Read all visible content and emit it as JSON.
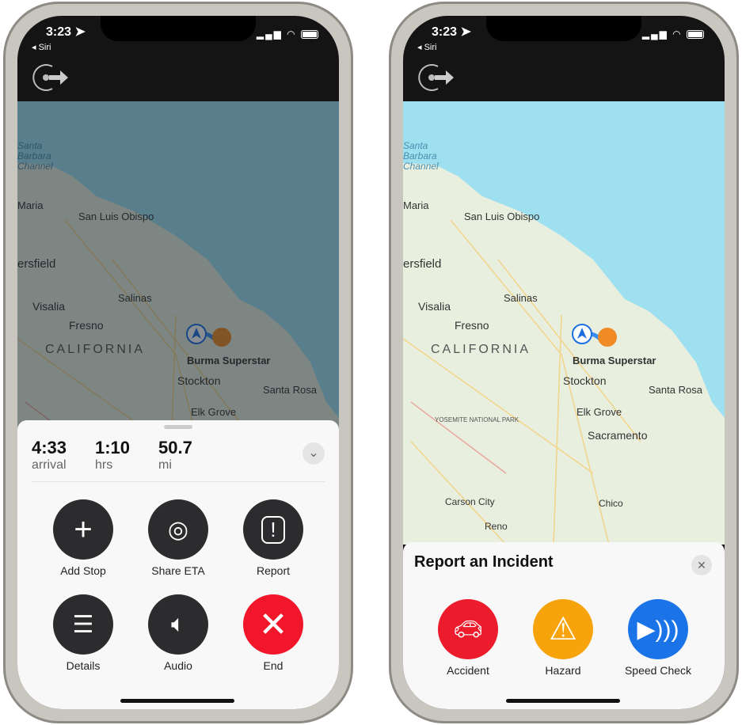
{
  "status": {
    "time": "3:23",
    "back": "Siri"
  },
  "map": {
    "water_label": "Santa\nBarbara\nChannel",
    "labels": [
      "Maria",
      "San Luis Obispo",
      "ersfield",
      "Visalia",
      "Fresno",
      "Salinas",
      "CALIFORNIA",
      "Burma Superstar",
      "Stockton",
      "Santa Rosa",
      "Elk Grove"
    ],
    "extra_labels": [
      "Sacramento",
      "YOSEMITE NATIONAL PARK",
      "Carson City",
      "Chico",
      "Reno"
    ]
  },
  "trip": {
    "arrival": "4:33",
    "arrival_unit": "arrival",
    "duration": "1:10",
    "duration_unit": "hrs",
    "distance": "50.7",
    "distance_unit": "mi"
  },
  "actions": [
    "Add Stop",
    "Share ETA",
    "Report",
    "Details",
    "Audio",
    "End"
  ],
  "report": {
    "title": "Report an Incident",
    "options": [
      "Accident",
      "Hazard",
      "Speed Check"
    ]
  },
  "colors": {
    "end": "#f2162b",
    "accident": "#ec1c2c",
    "hazard": "#f7a40c",
    "speed": "#1b73e8",
    "action": "#2c2c2e"
  }
}
